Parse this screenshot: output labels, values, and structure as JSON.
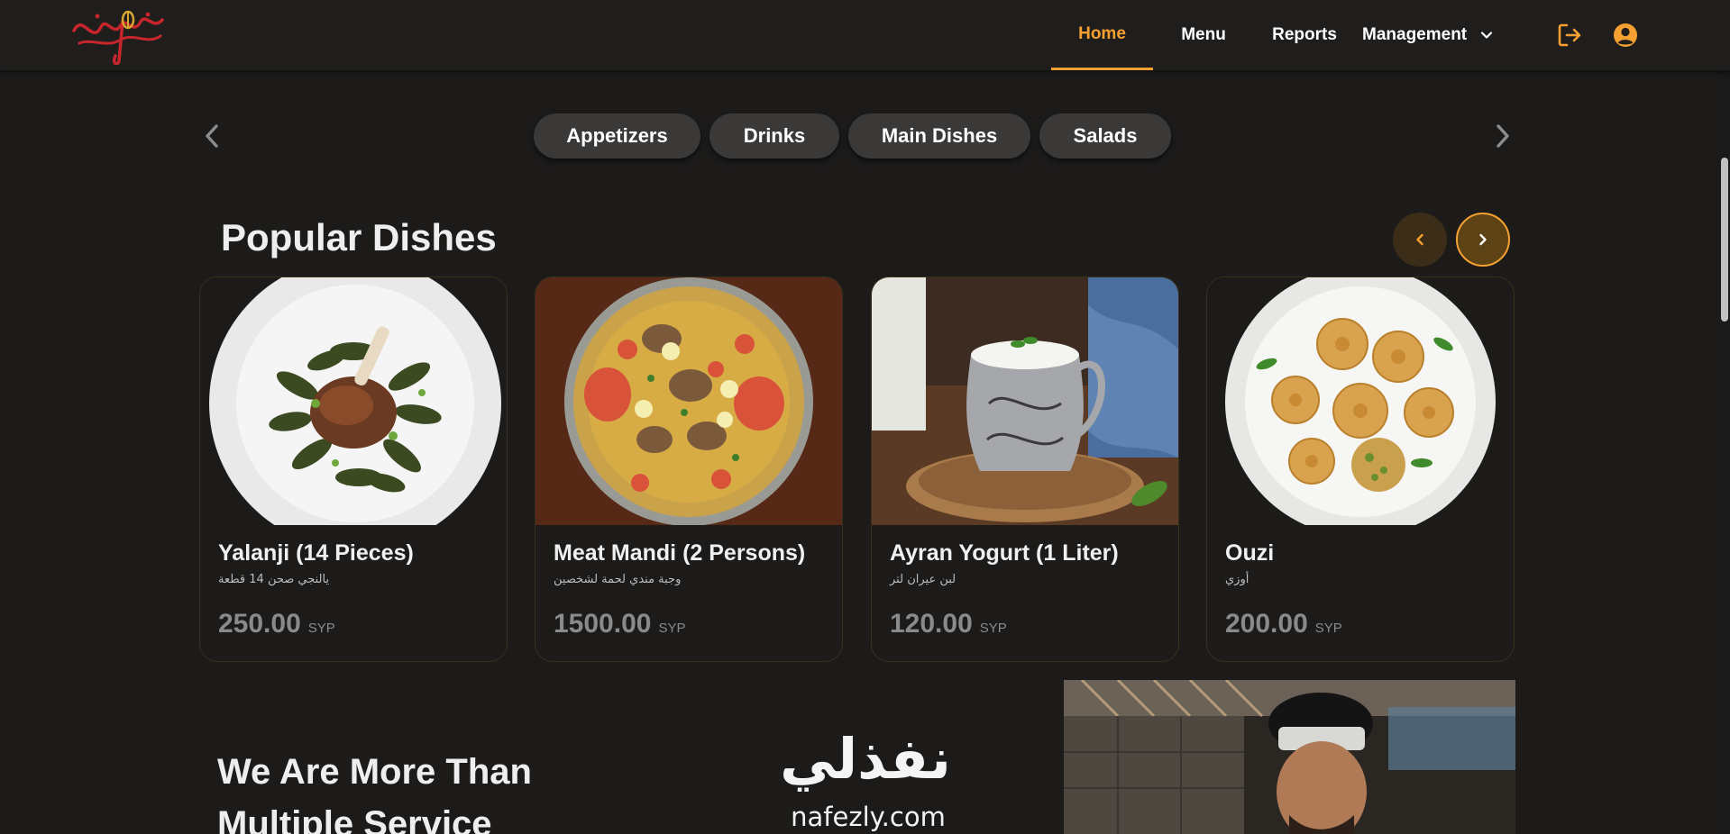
{
  "navbar": {
    "logo_alt": "restaurant-logo",
    "links": [
      {
        "label": "Home",
        "active": true
      },
      {
        "label": "Menu",
        "active": false
      },
      {
        "label": "Reports",
        "active": false
      },
      {
        "label": "Management",
        "active": false
      }
    ],
    "accent_color": "#f5a031"
  },
  "categories": {
    "items": [
      "Appetizers",
      "Drinks",
      "Main Dishes",
      "Salads"
    ]
  },
  "popular": {
    "title": "Popular Dishes",
    "dishes": [
      {
        "name": "Yalanji (14 Pieces)",
        "name_ar": "يالنجي صحن 14 قطعة",
        "price": "250.00",
        "currency": "SYP"
      },
      {
        "name": "Meat Mandi (2 Persons)",
        "name_ar": "وجبة مندي لحمة لشخصين",
        "price": "1500.00",
        "currency": "SYP"
      },
      {
        "name": "Ayran Yogurt (1 Liter)",
        "name_ar": "لبن عيران لتر",
        "price": "120.00",
        "currency": "SYP"
      },
      {
        "name": "Ouzi",
        "name_ar": "أوزي",
        "price": "200.00",
        "currency": "SYP"
      }
    ]
  },
  "about": {
    "title": "We Are More Than Multiple Service"
  },
  "brand": {
    "arabic": "نفذلي",
    "latin": "nafezly.com"
  },
  "icons": {
    "logout": "logout-icon",
    "user": "user-circle-icon",
    "chevron": "chevron-down-icon"
  }
}
